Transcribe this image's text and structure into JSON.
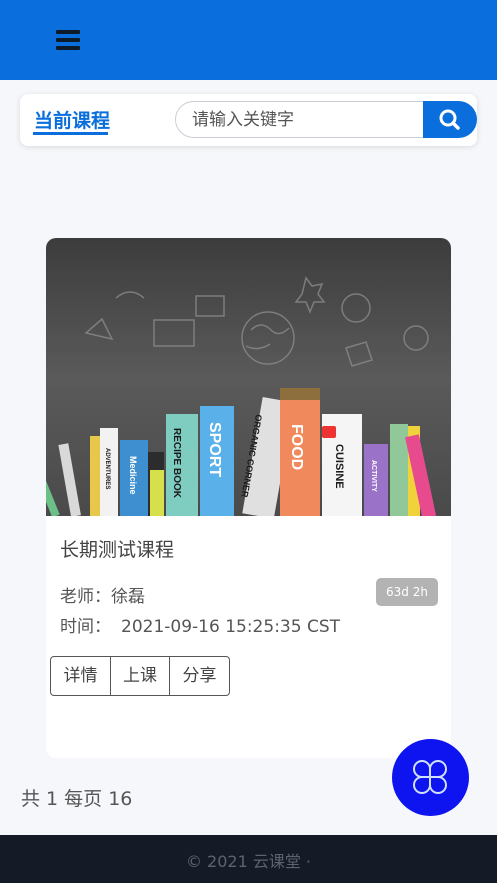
{
  "header": {
    "menu_icon": "hamburger-menu-icon"
  },
  "toolbar": {
    "current_tab_label": "当前课程",
    "search_placeholder": "请输入关键字",
    "search_icon": "search-icon"
  },
  "course": {
    "title": "长期测试课程",
    "teacher_label": "老师：",
    "teacher_name": "徐磊",
    "time_label": "时间：",
    "time_value": "2021-09-16 15:25:35 CST",
    "duration_badge": "63d 2h",
    "cover_books": [
      "RECIPE BOOK",
      "SPORT",
      "ORGANIC CORNER",
      "FOOD",
      "CUISINE",
      "ACTIVITY",
      "Medicine",
      "ADVENTURES"
    ],
    "actions": {
      "details": "详情",
      "attend": "上课",
      "share": "分享"
    }
  },
  "pagination": {
    "text": "共 1 每页 16"
  },
  "fab": {
    "icon": "clover-menu-icon"
  },
  "footer": {
    "text": "© 2021 云课堂 ·"
  },
  "colors": {
    "primary": "#0a6fdc",
    "fab": "#0e14f0",
    "footer_bg": "#141a26",
    "badge": "#b3b3b3"
  }
}
